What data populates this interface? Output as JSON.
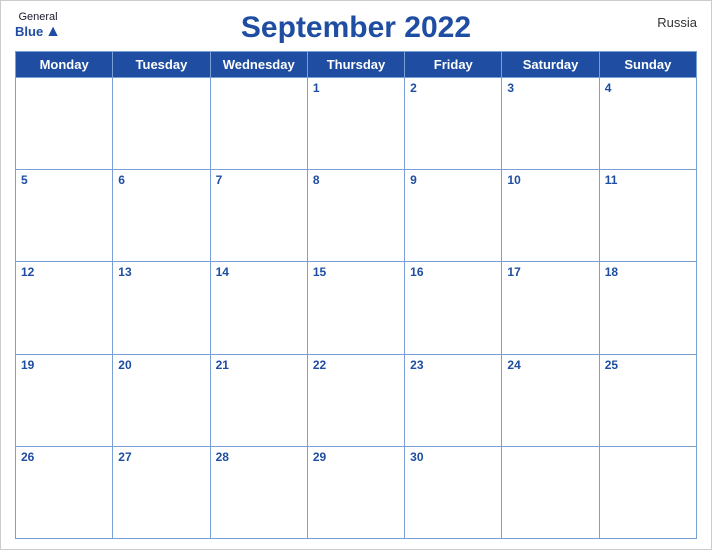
{
  "header": {
    "title": "September 2022",
    "country": "Russia",
    "logo_general": "General",
    "logo_blue": "Blue"
  },
  "days_of_week": [
    "Monday",
    "Tuesday",
    "Wednesday",
    "Thursday",
    "Friday",
    "Saturday",
    "Sunday"
  ],
  "weeks": [
    [
      null,
      null,
      null,
      1,
      2,
      3,
      4
    ],
    [
      5,
      6,
      7,
      8,
      9,
      10,
      11
    ],
    [
      12,
      13,
      14,
      15,
      16,
      17,
      18
    ],
    [
      19,
      20,
      21,
      22,
      23,
      24,
      25
    ],
    [
      26,
      27,
      28,
      29,
      30,
      null,
      null
    ]
  ]
}
